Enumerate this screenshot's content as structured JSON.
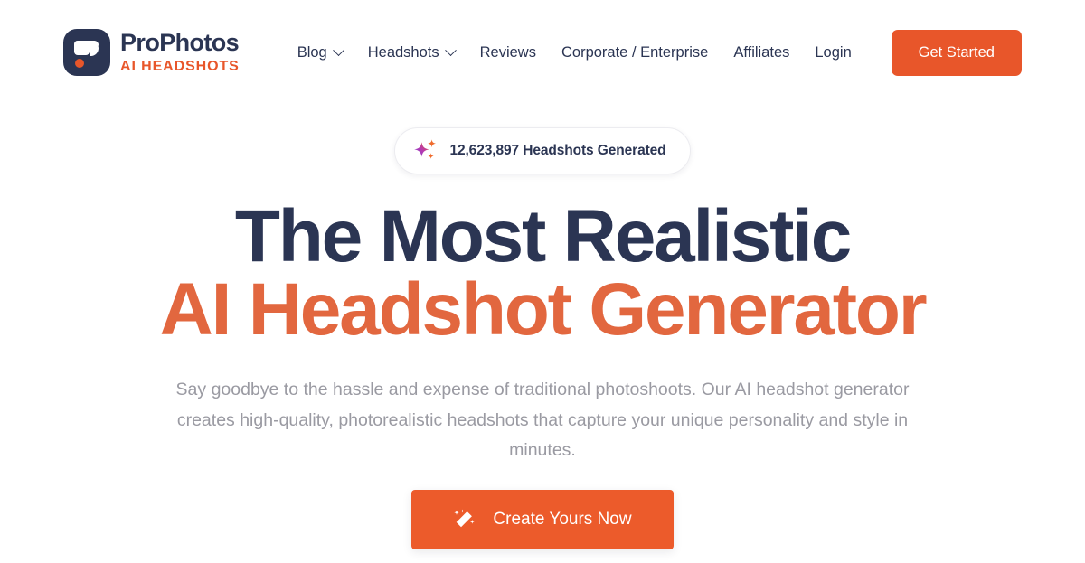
{
  "brand": {
    "name": "ProPhotos",
    "tagline": "AI HEADSHOTS",
    "logo_icon": "prophotos-logo-icon",
    "navy": "#2b3553",
    "orange": "#e8562a"
  },
  "nav": {
    "items": [
      {
        "label": "Blog",
        "has_dropdown": true,
        "icon": "chevron-down-icon"
      },
      {
        "label": "Headshots",
        "has_dropdown": true,
        "icon": "chevron-down-icon"
      },
      {
        "label": "Reviews",
        "has_dropdown": false
      },
      {
        "label": "Corporate / Enterprise",
        "has_dropdown": false
      },
      {
        "label": "Affiliates",
        "has_dropdown": false
      },
      {
        "label": "Login",
        "has_dropdown": false
      }
    ],
    "cta_label": "Get Started"
  },
  "hero": {
    "badge": {
      "icon": "sparkles-icon",
      "count": "12,623,897",
      "text": "12,623,897 Headshots Generated"
    },
    "title_line1": "The Most Realistic",
    "title_line2": "AI Headshot Generator",
    "subtitle": "Say goodbye to the hassle and expense of traditional photoshoots. Our AI headshot generator creates high-quality, photorealistic headshots that capture your unique personality and style in minutes.",
    "cta": {
      "label": "Create Yours Now",
      "icon": "magic-wand-icon",
      "color": "#ec5b2b"
    }
  }
}
